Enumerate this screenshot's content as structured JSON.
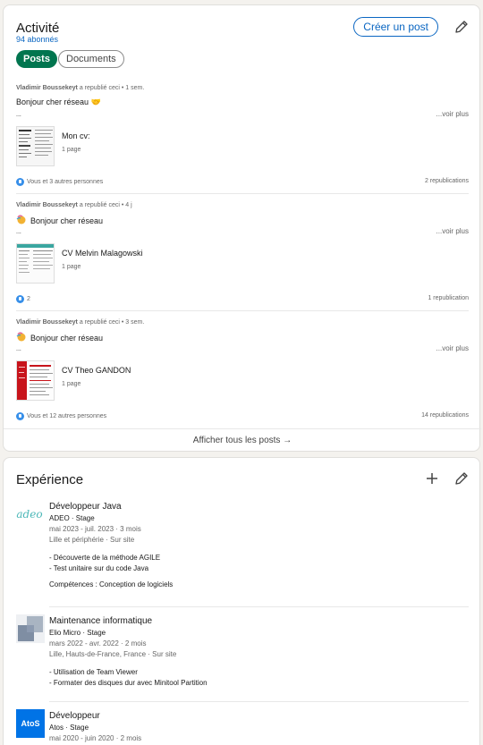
{
  "activity": {
    "title": "Activité",
    "followers": "94 abonnés",
    "create_button": "Créer un post",
    "tabs": [
      {
        "label": "Posts",
        "selected": true
      },
      {
        "label": "Documents",
        "selected": false
      }
    ],
    "posts": [
      {
        "author": "Vladimir Boussekeyt",
        "action": " a republié ceci • 1 sem.",
        "text": "Bonjour cher réseau 🤝",
        "ellipsis": "...",
        "see_more": "...voir plus",
        "doc_title": "Mon cv:",
        "doc_pages": "1 page",
        "reactions": "Vous et 3 autres personnes",
        "reposts": "2 republications"
      },
      {
        "author": "Vladimir Boussekeyt",
        "action": " a republié ceci • 4 j",
        "text": "Bonjour cher réseau",
        "ellipsis": "...",
        "see_more": "...voir plus",
        "doc_title": "CV Melvin Malagowski",
        "doc_pages": "1 page",
        "reactions": "2",
        "reposts": "1 republication"
      },
      {
        "author": "Vladimir Boussekeyt",
        "action": " a republié ceci • 3 sem.",
        "text": "Bonjour cher réseau",
        "ellipsis": "...",
        "see_more": "...voir plus",
        "doc_title": "CV Theo GANDON",
        "doc_pages": "1 page",
        "reactions": "Vous et 12 autres personnes",
        "reposts": "14 republications"
      }
    ],
    "show_all": "Afficher tous les posts →"
  },
  "experience": {
    "title": "Expérience",
    "items": [
      {
        "logo_text": "adeo",
        "role": "Développeur Java",
        "company": "ADEO · Stage",
        "dates": "mai 2023 - juil. 2023 · 3 mois",
        "location": "Lille et périphérie · Sur site",
        "desc1": "- Découverte de la méthode AGILE",
        "desc2": "- Test unitaire sur du code Java",
        "skills": "Compétences : Conception de logiciels"
      },
      {
        "logo_text": "",
        "role": "Maintenance informatique",
        "company": "Elio Micro · Stage",
        "dates": "mars 2022 - avr. 2022 · 2 mois",
        "location": "Lille, Hauts-de-France, France · Sur site",
        "desc1": "- Utilisation de Team Viewer",
        "desc2": "- Formater des disques dur avec Minitool Partition"
      },
      {
        "logo_text": "AtoS",
        "role": "Développeur",
        "company": "Atos · Stage",
        "dates": "mai 2020 - juin 2020 · 2 mois"
      }
    ]
  },
  "colors": {
    "accent": "#0a66c2",
    "tab_active": "#01754f",
    "atos_blue": "#0073e6",
    "adeo_teal": "#4cb8b8"
  }
}
